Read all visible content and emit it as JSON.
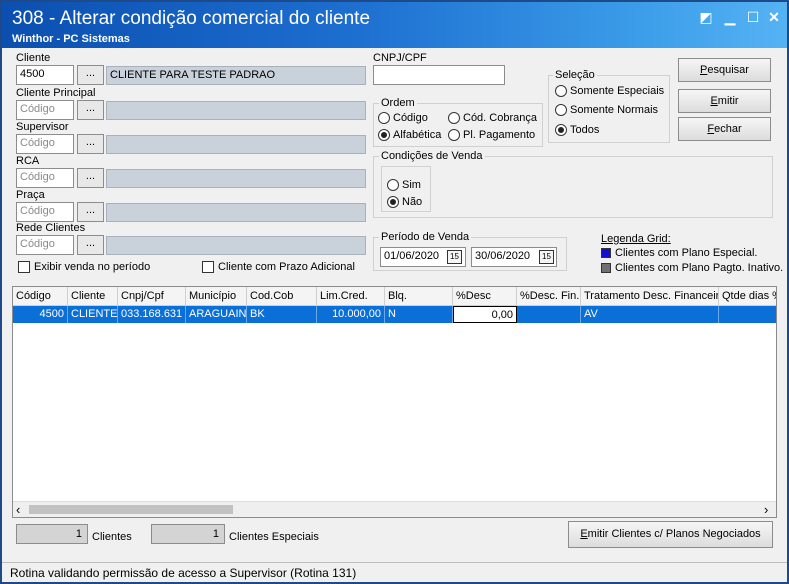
{
  "window": {
    "title": "308 - Alterar condição comercial do cliente",
    "subtitle": "Winthor - PC Sistemas",
    "controls": {
      "restore": "◩",
      "minimize": "▁",
      "maximize": "☐",
      "close": "✕"
    }
  },
  "filters": {
    "cliente": {
      "label": "Cliente",
      "code": "4500",
      "button": "...",
      "name": "CLIENTE PARA TESTE PADRAO"
    },
    "cliente_principal": {
      "label": "Cliente Principal",
      "placeholder": "Código",
      "button": "..."
    },
    "supervisor": {
      "label": "Supervisor",
      "placeholder": "Código",
      "button": "..."
    },
    "rca": {
      "label": "RCA",
      "placeholder": "Código",
      "button": "..."
    },
    "praca": {
      "label": "Praça",
      "placeholder": "Código",
      "button": "..."
    },
    "rede_clientes": {
      "label": "Rede Clientes",
      "placeholder": "Código",
      "button": "..."
    },
    "cnpj_cpf": {
      "label": "CNPJ/CPF",
      "value": ""
    },
    "exibir_venda": {
      "label": "Exibir venda no período",
      "checked": false
    },
    "prazo_adicional": {
      "label": "Cliente com Prazo Adicional",
      "checked": false
    }
  },
  "ordem": {
    "label": "Ordem",
    "options": [
      "Código",
      "Cód. Cobrança",
      "Alfabética",
      "Pl. Pagamento"
    ],
    "selected": "Alfabética"
  },
  "selecao": {
    "label": "Seleção",
    "options": [
      "Somente Especiais",
      "Somente Normais",
      "Todos"
    ],
    "selected": "Todos"
  },
  "condicoes_venda": {
    "label": "Condições de Venda",
    "options": [
      "Sim",
      "Não"
    ],
    "selected": "Não"
  },
  "periodo_venda": {
    "label": "Período de Venda",
    "start": "01/06/2020",
    "end": "30/06/2020",
    "calendar_glyph": "15"
  },
  "legenda": {
    "title": "Legenda Grid:",
    "items": [
      {
        "label": "Clientes com Plano Especial.",
        "color": "#1010d0"
      },
      {
        "label": "Clientes com Plano Pagto. Inativo.",
        "color": "#707070"
      }
    ]
  },
  "buttons": {
    "pesquisar": {
      "accel": "P",
      "rest": "esquisar"
    },
    "emitir": {
      "accel": "E",
      "rest": "mitir"
    },
    "fechar": {
      "accel": "F",
      "rest": "echar"
    },
    "emitir_planos": {
      "accel": "E",
      "rest": "mitir Clientes c/ Planos Negociados"
    }
  },
  "grid": {
    "columns": [
      "Código",
      "Cliente",
      "Cnpj/Cpf",
      "Município",
      "Cod.Cob",
      "Lim.Cred.",
      "Blq.",
      "%Desc",
      "%Desc. Fin.",
      "Tratamento Desc. Financeiro",
      "Qtde dias %"
    ],
    "rows": [
      [
        "4500",
        "CLIENTE P",
        "033.168.631",
        "ARAGUAINA",
        "BK",
        "10.000,00",
        "N",
        "0,00",
        "",
        "AV",
        ""
      ]
    ],
    "scroll_left": "‹",
    "scroll_right": "›"
  },
  "footer": {
    "clientes_count": "1",
    "clientes_label": "Clientes",
    "especiais_count": "1",
    "especiais_label": "Clientes Especiais"
  },
  "status": {
    "text": "Rotina validando permissão de acesso a Supervisor (Rotina 131)"
  },
  "colors": {
    "title_gradient_start": "#0b4fb0",
    "selection": "#0a6fd6"
  }
}
